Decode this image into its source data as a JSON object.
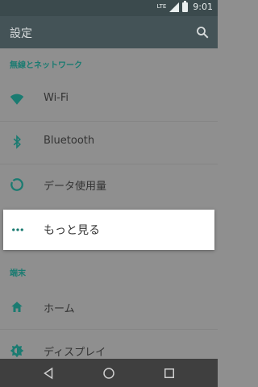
{
  "status_bar": {
    "network_type": "LTE",
    "time": "9:01"
  },
  "app_bar": {
    "title": "設定",
    "search_icon": "search-icon"
  },
  "sections": [
    {
      "header": "無線とネットワーク"
    },
    {
      "header": "端末"
    }
  ],
  "items": [
    {
      "label": "Wi-Fi",
      "icon": "wifi-icon"
    },
    {
      "label": "Bluetooth",
      "icon": "bluetooth-icon"
    },
    {
      "label": "データ使用量",
      "icon": "data-usage-icon"
    },
    {
      "label": "もっと見る",
      "icon": "more-dots-icon"
    },
    {
      "label": "ホーム",
      "icon": "home-icon"
    },
    {
      "label": "ディスプレイ",
      "icon": "display-brightness-icon"
    }
  ],
  "navigation": {
    "back_icon": "back-icon",
    "home_icon": "home-circle-icon",
    "recents_icon": "recents-icon"
  },
  "colors": {
    "status_bar": "#3b4a4d",
    "app_bar": "#445357",
    "accent_teal": "#1a7b71",
    "dim_overlay_bg": "#8f8f8f",
    "nav_bar": "#3f3f3f",
    "highlight_bg": "#ffffff"
  }
}
